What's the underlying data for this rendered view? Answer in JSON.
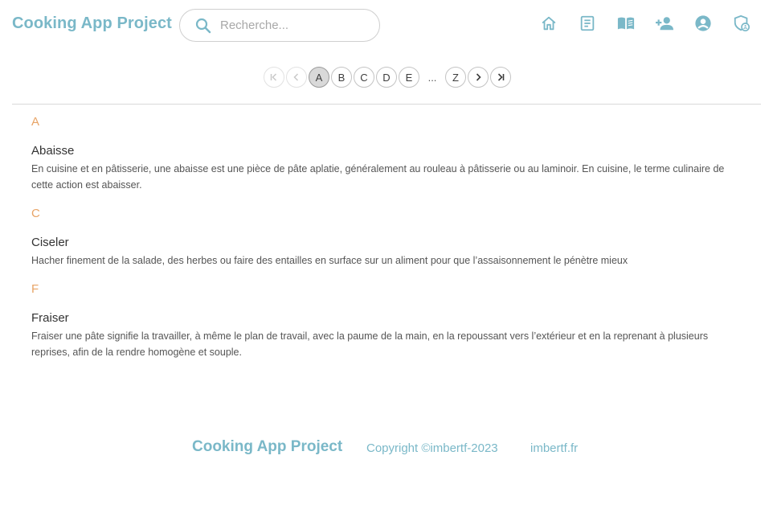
{
  "header": {
    "brand": "Cooking App Project",
    "search_placeholder": "Recherche...",
    "search_value": "",
    "nav_icons": [
      "home-icon",
      "article-icon",
      "book-icon",
      "add-user-icon",
      "account-icon",
      "admin-shield-icon"
    ]
  },
  "pagination": {
    "first_icon": "first-page-icon",
    "prev_icon": "prev-page-icon",
    "letters": [
      "A",
      "B",
      "C",
      "D",
      "E"
    ],
    "ellipsis": "...",
    "last_letter": "Z",
    "next_icon": "next-page-icon",
    "last_icon": "last-page-icon",
    "active": "A"
  },
  "glossary": [
    {
      "letter": "A",
      "term": "Abaisse",
      "definition": "En cuisine et en pâtisserie, une abaisse est une pièce de pâte aplatie, généralement au rouleau à pâtisserie ou au laminoir. En cuisine, le terme culinaire de cette action est abaisser."
    },
    {
      "letter": "C",
      "term": "Ciseler",
      "definition": "Hacher finement de la salade, des herbes ou faire des entailles en surface sur un aliment pour que l’assaisonnement le pénètre mieux"
    },
    {
      "letter": "F",
      "term": "Fraiser",
      "definition": "Fraiser une pâte signifie la travailler, à même le plan de travail, avec la paume de la main, en la repoussant vers l’extérieur et en la reprenant à plusieurs reprises, afin de la rendre homogène et souple."
    }
  ],
  "footer": {
    "brand": "Cooking App Project",
    "copyright": "Copyright ©imbertf-2023",
    "link": "imbertf.fr"
  },
  "colors": {
    "accent": "#7ab8c8",
    "letter": "#e8a466"
  }
}
